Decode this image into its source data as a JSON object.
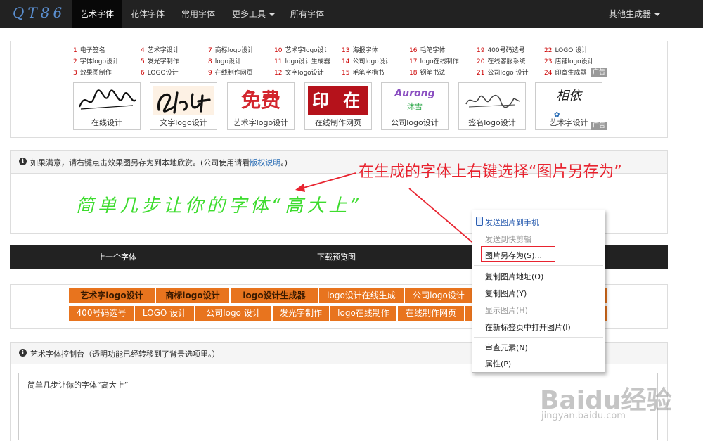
{
  "nav": {
    "brand": "QT86",
    "items": [
      "艺术字体",
      "花体字体",
      "常用字体",
      "更多工具",
      "所有字体"
    ],
    "right": "其他生成器"
  },
  "links": [
    {
      "n": "1",
      "t": "电子签名"
    },
    {
      "n": "2",
      "t": "字体logo设计"
    },
    {
      "n": "3",
      "t": "效果图制作"
    },
    {
      "n": "4",
      "t": "艺术字设计"
    },
    {
      "n": "5",
      "t": "发光字制作"
    },
    {
      "n": "6",
      "t": "LOGO设计"
    },
    {
      "n": "7",
      "t": "商标logo设计"
    },
    {
      "n": "8",
      "t": "logo设计"
    },
    {
      "n": "9",
      "t": "在线制作网页"
    },
    {
      "n": "10",
      "t": "艺术字logo设计"
    },
    {
      "n": "11",
      "t": "logo设计生成器"
    },
    {
      "n": "12",
      "t": "文字logo设计"
    },
    {
      "n": "13",
      "t": "海报字体"
    },
    {
      "n": "14",
      "t": "公司logo设计"
    },
    {
      "n": "15",
      "t": "毛笔字楷书"
    },
    {
      "n": "16",
      "t": "毛笔字体"
    },
    {
      "n": "17",
      "t": "logo在线制作"
    },
    {
      "n": "18",
      "t": "钢笔书法"
    },
    {
      "n": "19",
      "t": "400号码选号"
    },
    {
      "n": "20",
      "t": "在线客服系统"
    },
    {
      "n": "21",
      "t": "公司logo 设计"
    },
    {
      "n": "22",
      "t": "LOGO 设计"
    },
    {
      "n": "23",
      "t": "店铺logo设计"
    },
    {
      "n": "24",
      "t": "印章生成器"
    }
  ],
  "ad_label": "广告",
  "thumbs": [
    "在线设计",
    "文字logo设计",
    "艺术字logo设计",
    "在线制作网页",
    "公司logo设计",
    "签名logo设计",
    "艺术字设计"
  ],
  "thumb_art": {
    "t3": "免费",
    "t4": "印 在",
    "t5": "Aurong",
    "t5b": "沐雪",
    "t7": "相依"
  },
  "info": {
    "text": "如果满意，请右键点击效果图另存为到本地欣赏。(公司使用请看",
    "link": "版权说明",
    "tail": "。)"
  },
  "preview_text": "简单几步让你的字体“高大上”",
  "annotation": "在生成的字体上右键选择“图片另存为”",
  "darkbar": {
    "prev": "上一个字体",
    "download": "下载预览图"
  },
  "tags_row1": [
    "艺术字logo设计",
    "商标logo设计",
    "logo设计生成器",
    "logo设计在线生成",
    "公司logo设计"
  ],
  "tags_row2": [
    "400号码选号",
    "LOGO 设计",
    "公司logo 设计",
    "发光字制作",
    "logo在线制作",
    "在线制作网页"
  ],
  "console": {
    "title": "艺术字体控制台（透明功能已经转移到了背景选项里。）",
    "input": "简单几步让你的字体“高大上”"
  },
  "context_menu": {
    "items": [
      "发送图片到手机",
      "发送到快剪辑",
      "图片另存为(S)...",
      "复制图片地址(O)",
      "复制图片(Y)",
      "显示图片(H)",
      "在新标签页中打开图片(I)",
      "审查元素(N)",
      "属性(P)"
    ]
  },
  "watermark": {
    "main": "Baidu经验",
    "url": "jingyan.baidu.com"
  }
}
